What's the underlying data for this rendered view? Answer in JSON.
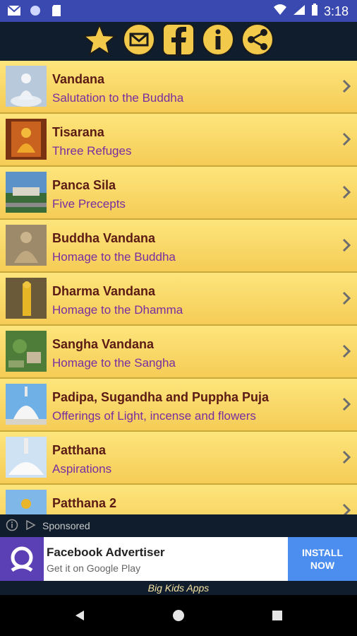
{
  "status_bar": {
    "time": "3:18"
  },
  "toolbar": {
    "buttons": [
      {
        "icon": "star-icon"
      },
      {
        "icon": "mail-icon"
      },
      {
        "icon": "facebook-icon"
      },
      {
        "icon": "info-icon"
      },
      {
        "icon": "share-icon"
      }
    ]
  },
  "list": {
    "items": [
      {
        "title": "Vandana",
        "subtitle": "Salutation to the Buddha"
      },
      {
        "title": "Tisarana",
        "subtitle": "Three Refuges"
      },
      {
        "title": "Panca Sila",
        "subtitle": "Five Precepts"
      },
      {
        "title": "Buddha Vandana",
        "subtitle": "Homage to the Buddha"
      },
      {
        "title": "Dharma Vandana",
        "subtitle": "Homage to the Dhamma"
      },
      {
        "title": "Sangha Vandana",
        "subtitle": "Homage to the Sangha"
      },
      {
        "title": "Padipa, Sugandha and Puppha Puja",
        "subtitle": "Offerings of Light, incense and flowers"
      },
      {
        "title": "Patthana",
        "subtitle": "Aspirations"
      },
      {
        "title": "Patthana 2",
        "subtitle": ""
      }
    ]
  },
  "ad": {
    "sponsored_label": "Sponsored",
    "title": "Facebook Advertiser",
    "subtitle": "Get it on Google Play",
    "install_label": "INSTALL\nNOW"
  },
  "footer": {
    "text": "Big Kids Apps"
  },
  "colors": {
    "accent": "#3a49b0",
    "toolbar": "#0f1d2c",
    "row": "#fde57c",
    "title": "#5b1a14",
    "subtitle": "#7a2da0"
  }
}
